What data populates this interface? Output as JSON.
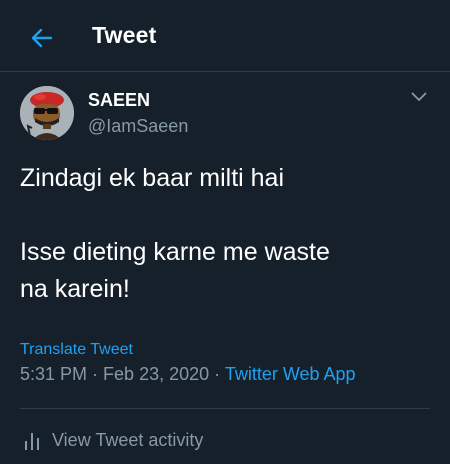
{
  "header": {
    "title": "Tweet",
    "back_icon": "arrow-left-icon"
  },
  "tweet": {
    "author": {
      "display_name": "SAEEN",
      "handle": "@IamSaeen"
    },
    "text": {
      "line1": "Zindagi ek baar milti hai",
      "line2": "Isse dieting karne me waste",
      "line3": "na karein!"
    },
    "translate_label": "Translate Tweet",
    "time": "5:31 PM",
    "sep1": " · ",
    "date": "Feb 23, 2020",
    "sep2": " · ",
    "source": "Twitter Web App",
    "activity_label": "View Tweet activity"
  },
  "colors": {
    "background": "#15202b",
    "accent": "#1da1f2",
    "secondary_text": "#8899a6",
    "divider": "#2f3b47"
  }
}
